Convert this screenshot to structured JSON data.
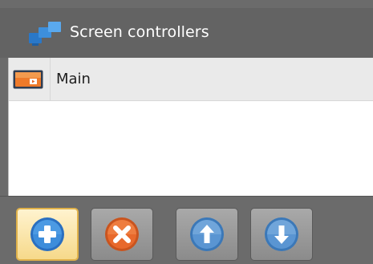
{
  "panel": {
    "title": "Screen controllers",
    "title_icon": "screens-icon"
  },
  "list": {
    "items": [
      {
        "label": "Main",
        "icon": "screen-icon",
        "selected": true
      }
    ]
  },
  "toolbar": {
    "buttons": [
      {
        "name": "add",
        "icon": "plus-icon",
        "hovered": true
      },
      {
        "name": "remove",
        "icon": "close-icon",
        "hovered": false
      },
      {
        "name": "move-up",
        "icon": "arrow-up-icon",
        "hovered": false
      },
      {
        "name": "move-down",
        "icon": "arrow-down-icon",
        "hovered": false
      }
    ]
  },
  "colors": {
    "title_bar": "#636363",
    "accent_blue": "#2a78c8",
    "accent_orange": "#e8692c",
    "hover_fill": "#f6d98a",
    "row_selected": "#eaeaea"
  }
}
